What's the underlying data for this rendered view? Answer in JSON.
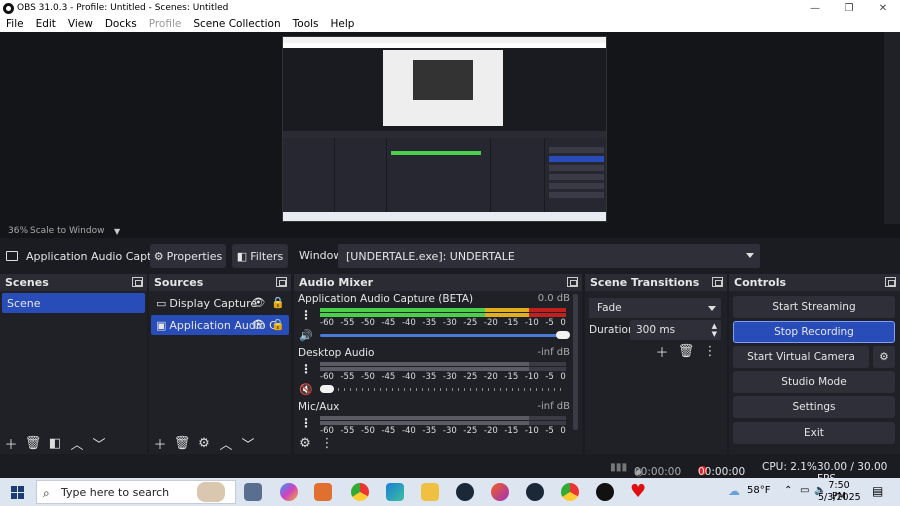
{
  "window": {
    "title": "OBS 31.0.3 - Profile: Untitled - Scenes: Untitled",
    "minimize": "—",
    "maximize": "❐",
    "close": "✕"
  },
  "menu": [
    "File",
    "Edit",
    "View",
    "Docks",
    "Profile",
    "Scene Collection",
    "Tools",
    "Help"
  ],
  "preview": {
    "zoom": "36%",
    "scale_mode": "Scale to Window"
  },
  "source_toolbar": {
    "source_name": "Application Audio Capture",
    "properties": "Properties",
    "filters": "Filters",
    "window_label": "Window",
    "window_value": "[UNDERTALE.exe]: UNDERTALE"
  },
  "scenes": {
    "title": "Scenes",
    "items": [
      "Scene"
    ]
  },
  "sources": {
    "title": "Sources",
    "items": [
      "Display Capture",
      "Application Audio C"
    ]
  },
  "mixer": {
    "title": "Audio Mixer",
    "ticks": [
      "-60",
      "-55",
      "-50",
      "-45",
      "-40",
      "-35",
      "-30",
      "-25",
      "-20",
      "-15",
      "-10",
      "-5",
      "0"
    ],
    "channels": [
      {
        "name": "Application Audio Capture (BETA)",
        "db": "0.0 dB",
        "volume": 1.0,
        "level": 1.0
      },
      {
        "name": "Desktop Audio",
        "db": "-inf dB",
        "volume": 0.0,
        "level": 0.0
      },
      {
        "name": "Mic/Aux",
        "db": "-inf dB",
        "volume": 0.0,
        "level": 0.0
      }
    ]
  },
  "transitions": {
    "title": "Scene Transitions",
    "selected": "Fade",
    "duration_label": "Duration",
    "duration_value": "300 ms"
  },
  "controls": {
    "title": "Controls",
    "start_streaming": "Start Streaming",
    "stop_recording": "Stop Recording",
    "start_virtual_camera": "Start Virtual Camera",
    "studio_mode": "Studio Mode",
    "settings": "Settings",
    "exit": "Exit"
  },
  "status": {
    "stream_time": "00:00:00",
    "rec_time": "00:00:00",
    "cpu": "CPU: 2.1%",
    "fps": "30.00 / 30.00 FPS"
  },
  "taskbar": {
    "search_placeholder": "Type here to search",
    "weather": "58°F",
    "time": "7:50 PM",
    "date": "5/3/2025"
  },
  "colors": {
    "accent": "#284cb8",
    "meter_green": "#4bd04b",
    "meter_yellow": "#e0b020",
    "meter_red": "#c02020"
  }
}
